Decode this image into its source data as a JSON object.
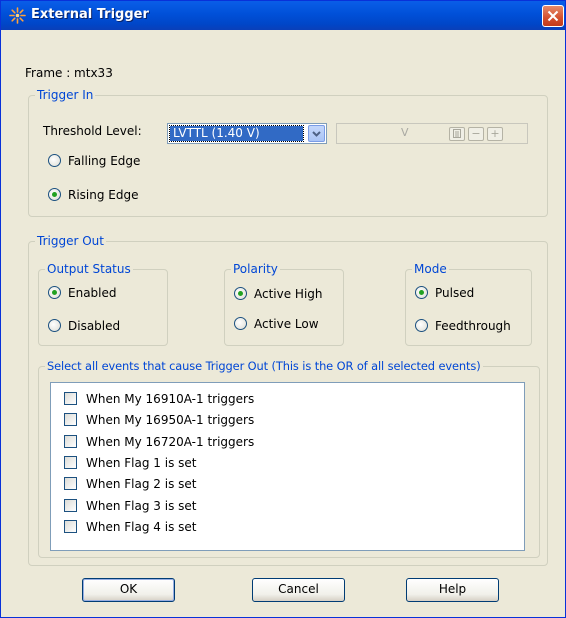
{
  "window": {
    "title": "External Trigger"
  },
  "frame": {
    "label": "Frame : mtx33"
  },
  "trigger_in": {
    "legend": "Trigger In",
    "threshold_label": "Threshold Level:",
    "threshold_value": "LVTTL (1.40 V)",
    "voltage_unit": "V",
    "falling_edge_label": "Falling Edge",
    "rising_edge_label": "Rising Edge",
    "selected": "Rising Edge"
  },
  "trigger_out": {
    "legend": "Trigger Out",
    "output_status": {
      "legend": "Output Status",
      "enabled_label": "Enabled",
      "disabled_label": "Disabled",
      "selected": "Enabled"
    },
    "polarity": {
      "legend": "Polarity",
      "active_high_label": "Active High",
      "active_low_label": "Active Low",
      "selected": "Active High"
    },
    "mode": {
      "legend": "Mode",
      "pulsed_label": "Pulsed",
      "feedthrough_label": "Feedthrough",
      "selected": "Pulsed"
    },
    "events": {
      "legend": "Select all events that cause Trigger Out (This is the OR of all selected events)",
      "items": [
        {
          "label": "When My 16910A-1 triggers",
          "checked": false
        },
        {
          "label": "When My 16950A-1 triggers",
          "checked": false
        },
        {
          "label": "When My 16720A-1 triggers",
          "checked": false
        },
        {
          "label": "When Flag 1 is set",
          "checked": false
        },
        {
          "label": "When Flag 2 is set",
          "checked": false
        },
        {
          "label": "When Flag 3 is set",
          "checked": false
        },
        {
          "label": "When Flag 4 is set",
          "checked": false
        }
      ]
    }
  },
  "buttons": {
    "ok": "OK",
    "cancel": "Cancel",
    "help": "Help"
  },
  "colors": {
    "title_bar": "#0050d8",
    "group_legend": "#0046d5",
    "dialog_background": "#ece9d8",
    "selection": "#316ac5",
    "radio_dot": "#21a121"
  }
}
